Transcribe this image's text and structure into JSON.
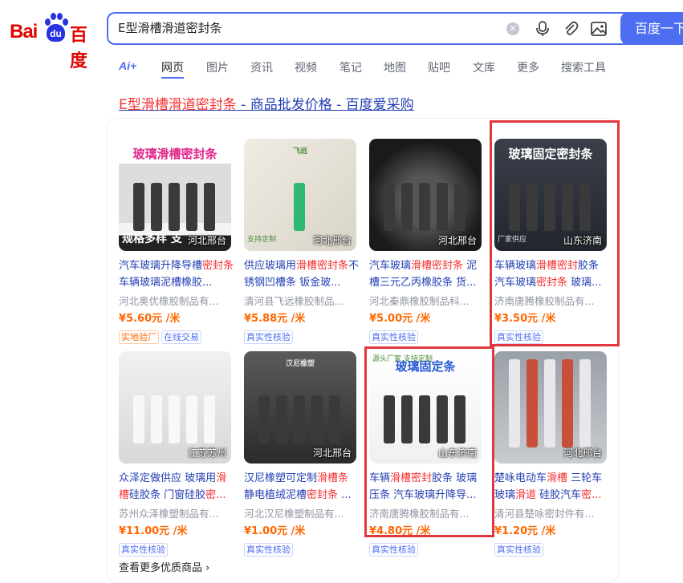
{
  "logo": {
    "text_bai": "Bai",
    "text_du": "du",
    "text_cn": "百度"
  },
  "search": {
    "query": "E型滑槽滑道密封条",
    "button": "百度一下"
  },
  "tabs": [
    {
      "label": "Ai+"
    },
    {
      "label": "网页"
    },
    {
      "label": "图片"
    },
    {
      "label": "资讯"
    },
    {
      "label": "视频"
    },
    {
      "label": "笔记"
    },
    {
      "label": "地图"
    },
    {
      "label": "贴吧"
    },
    {
      "label": "文库"
    },
    {
      "label": "更多"
    },
    {
      "label": "搜索工具"
    }
  ],
  "result": {
    "title_hl": "E型滑槽滑道密封条",
    "title_rest": " - 商品批发价格 - 百度爱采购"
  },
  "products": [
    {
      "img_text": "玻璃滑槽密封条",
      "img_sub": "规格多样 支",
      "location": "河北邢台",
      "desc": [
        [
          "汽车玻璃升降导槽",
          ""
        ],
        [
          "密封条",
          "hl"
        ],
        [
          "车辆玻璃泥槽橡胶...",
          ""
        ]
      ],
      "seller": "河北奥优橡胶制品有...",
      "price": "¥5.60元 /米",
      "badges": [
        "实地验厂",
        "在线交易"
      ]
    },
    {
      "img_text": "飞远",
      "img_sub": "支持定制",
      "location": "河北邢台",
      "desc": [
        [
          "供应玻璃用",
          ""
        ],
        [
          "滑槽密封条",
          "hl"
        ],
        [
          "不锈钢凹槽条 钣金玻...",
          ""
        ]
      ],
      "seller": "清河县飞远橡胶制品...",
      "price": "¥5.88元 /米",
      "badges": [
        "真实性核验"
      ]
    },
    {
      "img_text": "",
      "img_sub": "",
      "location": "河北邢台",
      "desc": [
        [
          "汽车玻璃",
          ""
        ],
        [
          "滑槽密封条",
          "hl"
        ],
        [
          " 泥槽三元乙丙橡胶条 货...",
          ""
        ]
      ],
      "seller": "河北秦鼎橡胶制品科...",
      "price": "¥5.00元 /米",
      "badges": [
        "真实性核验"
      ]
    },
    {
      "img_text": "玻璃固定密封条",
      "img_sub": "厂家供应",
      "location": "山东济南",
      "desc": [
        [
          "车辆玻璃",
          ""
        ],
        [
          "滑槽密封",
          "hl"
        ],
        [
          "胶条 汽车玻璃",
          ""
        ],
        [
          "密封条",
          "hl"
        ],
        [
          " 玻璃...",
          ""
        ]
      ],
      "seller": "济南唐腾橡胶制品有...",
      "price": "¥3.50元 /米",
      "badges": [
        "真实性核验"
      ]
    },
    {
      "img_text": "",
      "img_sub": "",
      "location": "江苏苏州",
      "desc": [
        [
          "众泽定做供应 玻璃用",
          ""
        ],
        [
          "滑槽",
          "hl"
        ],
        [
          "硅胶条 门窗硅胶",
          ""
        ],
        [
          "密...",
          "hl"
        ]
      ],
      "seller": "苏州众泽橡塑制品有...",
      "price": "¥11.00元 /米",
      "badges": [
        "真实性核验"
      ]
    },
    {
      "img_text": "汉尼橡塑",
      "img_sub": "",
      "location": "河北邢台",
      "desc": [
        [
          "汉尼橡塑可定制",
          ""
        ],
        [
          "滑槽条",
          "hl"
        ],
        [
          " 静电植绒泥槽",
          ""
        ],
        [
          "密封条",
          "hl"
        ],
        [
          " ...",
          ""
        ]
      ],
      "seller": "河北汉尼橡塑制品有...",
      "price": "¥1.00元 /米",
      "badges": [
        "真实性核验"
      ]
    },
    {
      "img_text": "玻璃固定条",
      "img_sub": "源头厂家 支持定制",
      "location": "山东济南",
      "desc": [
        [
          "车辆",
          ""
        ],
        [
          "滑槽密封",
          "hl"
        ],
        [
          "胶条 玻璃压条 汽车玻璃升降导...",
          ""
        ]
      ],
      "seller": "济南唐腾橡胶制品有...",
      "price": "¥4.80元 /米",
      "badges": [
        "真实性核验"
      ]
    },
    {
      "img_text": "",
      "img_sub": "",
      "location": "河北邢台",
      "desc": [
        [
          "楚咏电动车",
          ""
        ],
        [
          "滑槽",
          "hl"
        ],
        [
          " 三轮车玻璃",
          ""
        ],
        [
          "滑道",
          "hl"
        ],
        [
          " 硅胶汽车",
          ""
        ],
        [
          "密...",
          "hl"
        ]
      ],
      "seller": "清河县楚咏密封件有...",
      "price": "¥1.20元 /米",
      "badges": [
        "真实性核验"
      ]
    }
  ],
  "more_link": "查看更多优质商品 ›",
  "colors": {
    "brand_blue": "#4e6ef2",
    "baidu_red": "#e10602",
    "link": "#2440b3",
    "highlight": "#f73131",
    "price": "#ff6600",
    "annotation": "#e0383e"
  }
}
